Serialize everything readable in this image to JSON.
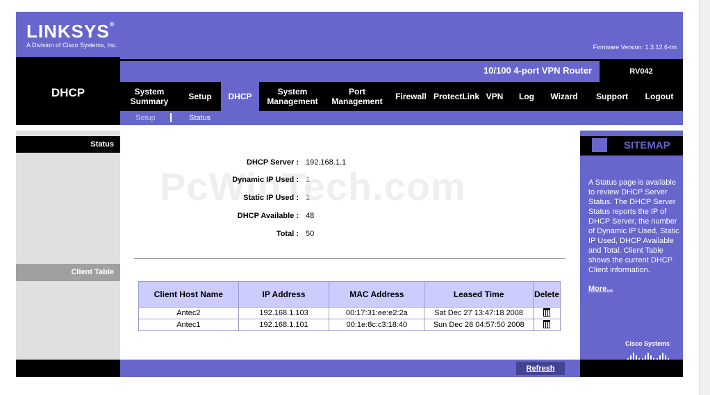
{
  "header": {
    "brand": "LINKSYS",
    "brand_sub": "A Division of Cisco Systems, Inc.",
    "firmware": "Firmware Version: 1.3.12.6-tm",
    "product_name": "10/100 4-port VPN Router",
    "model": "RV042"
  },
  "page_title": "DHCP",
  "nav": {
    "items": [
      {
        "label": "System Summary"
      },
      {
        "label": "Setup"
      },
      {
        "label": "DHCP"
      },
      {
        "label": "System Management"
      },
      {
        "label": "Port Management"
      },
      {
        "label": "Firewall"
      },
      {
        "label": "ProtectLink"
      },
      {
        "label": "VPN"
      },
      {
        "label": "Log"
      },
      {
        "label": "Wizard"
      },
      {
        "label": "Support"
      },
      {
        "label": "Logout"
      }
    ],
    "sub": [
      "Setup",
      "Status"
    ]
  },
  "sections": {
    "status": "Status",
    "client_table": "Client Table"
  },
  "status": {
    "dhcp_server_label": "DHCP Server :",
    "dhcp_server_value": "192.168.1.1",
    "dynamic_ip_label": "Dynamic IP Used :",
    "dynamic_ip_value": "1",
    "static_ip_label": "Static IP Used :",
    "static_ip_value": "1",
    "available_label": "DHCP Available :",
    "available_value": "48",
    "total_label": "Total :",
    "total_value": "50"
  },
  "watermark": "PcWinTech.com",
  "client_table": {
    "headers": [
      "Client Host Name",
      "IP Address",
      "MAC Address",
      "Leased Time",
      "Delete"
    ],
    "rows": [
      {
        "host": "Antec2",
        "ip": "192.168.1.103",
        "mac": "00:17:31:ee:e2:2a",
        "leased": "Sat Dec 27 13:47:18 2008"
      },
      {
        "host": "Antec1",
        "ip": "192.168.1.101",
        "mac": "00:1e:8c:c3:18:40",
        "leased": "Sun Dec 28 04:57:50 2008"
      }
    ]
  },
  "sidebar": {
    "title": "SITEMAP",
    "help": "A Status page is available to review DHCP Server Status. The DHCP Server Status reports the IP of DHCP Server, the number of Dynamic IP Used, Static IP Used, DHCP Available and Total. Client Table shows the current DHCP Client information.",
    "more": "More...",
    "cisco": "Cisco Systems"
  },
  "footer": {
    "refresh": "Refresh"
  },
  "colors": {
    "accent": "#6666cc",
    "header_bg": "#000000",
    "table_header": "#ccccff"
  }
}
